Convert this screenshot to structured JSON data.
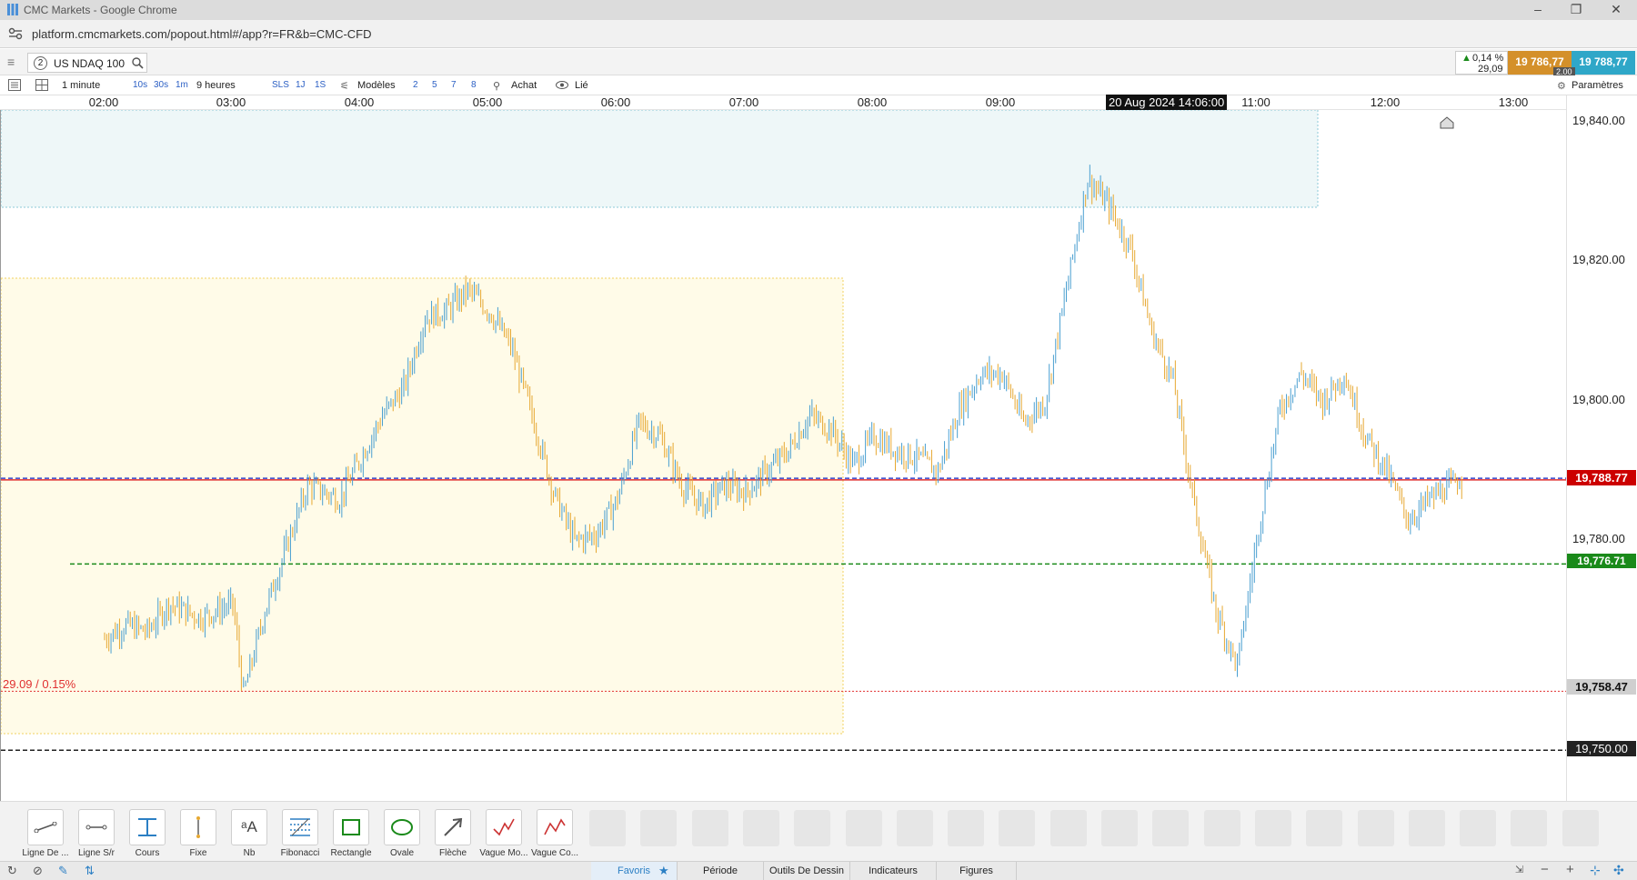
{
  "window": {
    "title": "CMC Markets - Google Chrome"
  },
  "browser": {
    "url": "platform.cmcmarkets.com/popout.html#/app?r=FR&b=CMC-CFD"
  },
  "instrument": {
    "number": "2",
    "name": "US NDAQ 100",
    "change_pct": "0,14 %",
    "change_pts": "29,09",
    "sell_price": "19 786,77",
    "buy_price": "19 788,77",
    "spread": "2.00"
  },
  "toolbar": {
    "interval": "1 minute",
    "quick_intervals": [
      "10s",
      "30s",
      "1m"
    ],
    "range": "9 heures",
    "quick_ranges": [
      "SLS",
      "1J",
      "1S"
    ],
    "templates_label": "Modèles",
    "template_numbers": [
      "2",
      "5",
      "7",
      "8"
    ],
    "order_label": "Achat",
    "linked_label": "Lié",
    "settings_label": "Paramètres"
  },
  "chart": {
    "crosshair_time": "20 Aug 2024 14:06:00",
    "time_labels": [
      "02:00",
      "03:00",
      "04:00",
      "05:00",
      "06:00",
      "07:00",
      "08:00",
      "09:00",
      "11:00",
      "12:00",
      "13:00"
    ],
    "price_ticks": [
      "19,840.00",
      "19,820.00",
      "19,800.00",
      "19,780.00"
    ],
    "current_price_label": "19,788.77",
    "green_line_label": "19,776.71",
    "red_line_label": "19,758.47",
    "black_line_label": "19,750.00",
    "change_annotation": "29.09 / 0.15%",
    "colors": {
      "up": "#4a9fd0",
      "down": "#e6a832",
      "current": "#cc0000",
      "green": "#1a8a1a"
    }
  },
  "chart_data": {
    "type": "bar",
    "title": "",
    "series_kind": "OHLC 1-minute",
    "x_start": "02:00",
    "x_end": "13:30",
    "ylim": [
      19744,
      19842
    ],
    "horizontal_lines": [
      {
        "value": 19788.77,
        "color": "red",
        "style": "solid"
      },
      {
        "value": 19789.0,
        "color": "blue",
        "style": "dashed"
      },
      {
        "value": 19776.71,
        "color": "green",
        "style": "dashed"
      },
      {
        "value": 19758.47,
        "color": "red",
        "style": "dotted"
      },
      {
        "value": 19750.0,
        "color": "black",
        "style": "dashed"
      }
    ],
    "path_points": [
      [
        "02:00",
        19766
      ],
      [
        "02:10",
        19768
      ],
      [
        "02:20",
        19767
      ],
      [
        "02:30",
        19771
      ],
      [
        "02:45",
        19769
      ],
      [
        "03:00",
        19771
      ],
      [
        "03:05",
        19758
      ],
      [
        "03:15",
        19770
      ],
      [
        "03:25",
        19779
      ],
      [
        "03:35",
        19788
      ],
      [
        "03:50",
        19786
      ],
      [
        "04:00",
        19792
      ],
      [
        "04:10",
        19798
      ],
      [
        "04:20",
        19802
      ],
      [
        "04:30",
        19812
      ],
      [
        "04:40",
        19813
      ],
      [
        "04:50",
        19816
      ],
      [
        "05:00",
        19813
      ],
      [
        "05:10",
        19808
      ],
      [
        "05:20",
        19798
      ],
      [
        "05:30",
        19787
      ],
      [
        "05:40",
        19780
      ],
      [
        "05:50",
        19781
      ],
      [
        "06:00",
        19786
      ],
      [
        "06:10",
        19797
      ],
      [
        "06:20",
        19795
      ],
      [
        "06:30",
        19788
      ],
      [
        "06:40",
        19785
      ],
      [
        "06:50",
        19788
      ],
      [
        "07:00",
        19787
      ],
      [
        "07:10",
        19790
      ],
      [
        "07:20",
        19793
      ],
      [
        "07:30",
        19798
      ],
      [
        "07:40",
        19796
      ],
      [
        "07:50",
        19791
      ],
      [
        "08:00",
        19795
      ],
      [
        "08:10",
        19793
      ],
      [
        "08:20",
        19792
      ],
      [
        "08:30",
        19790
      ],
      [
        "08:40",
        19799
      ],
      [
        "08:50",
        19804
      ],
      [
        "09:00",
        19804
      ],
      [
        "09:10",
        19797
      ],
      [
        "09:20",
        19800
      ],
      [
        "09:30",
        19816
      ],
      [
        "09:40",
        19832
      ],
      [
        "09:50",
        19828
      ],
      [
        "10:00",
        19822
      ],
      [
        "10:10",
        19810
      ],
      [
        "10:20",
        19803
      ],
      [
        "10:30",
        19785
      ],
      [
        "10:40",
        19770
      ],
      [
        "10:50",
        19762
      ],
      [
        "11:00",
        19782
      ],
      [
        "11:10",
        19799
      ],
      [
        "11:20",
        19804
      ],
      [
        "11:30",
        19800
      ],
      [
        "11:40",
        19804
      ],
      [
        "11:50",
        19795
      ],
      [
        "12:00",
        19790
      ],
      [
        "12:10",
        19783
      ],
      [
        "12:20",
        19786
      ],
      [
        "12:30",
        19788
      ],
      [
        "12:35",
        19789
      ]
    ]
  },
  "drawing_tools": [
    "Ligne De ...",
    "Ligne S/r",
    "Cours",
    "Fixe",
    "Nb",
    "Fibonacci",
    "Rectangle",
    "Ovale",
    "Flèche",
    "Vague Mo...",
    "Vague Co..."
  ],
  "bottom_tabs": [
    "Favoris",
    "Période",
    "Outils De Dessin",
    "Indicateurs",
    "Figures"
  ]
}
